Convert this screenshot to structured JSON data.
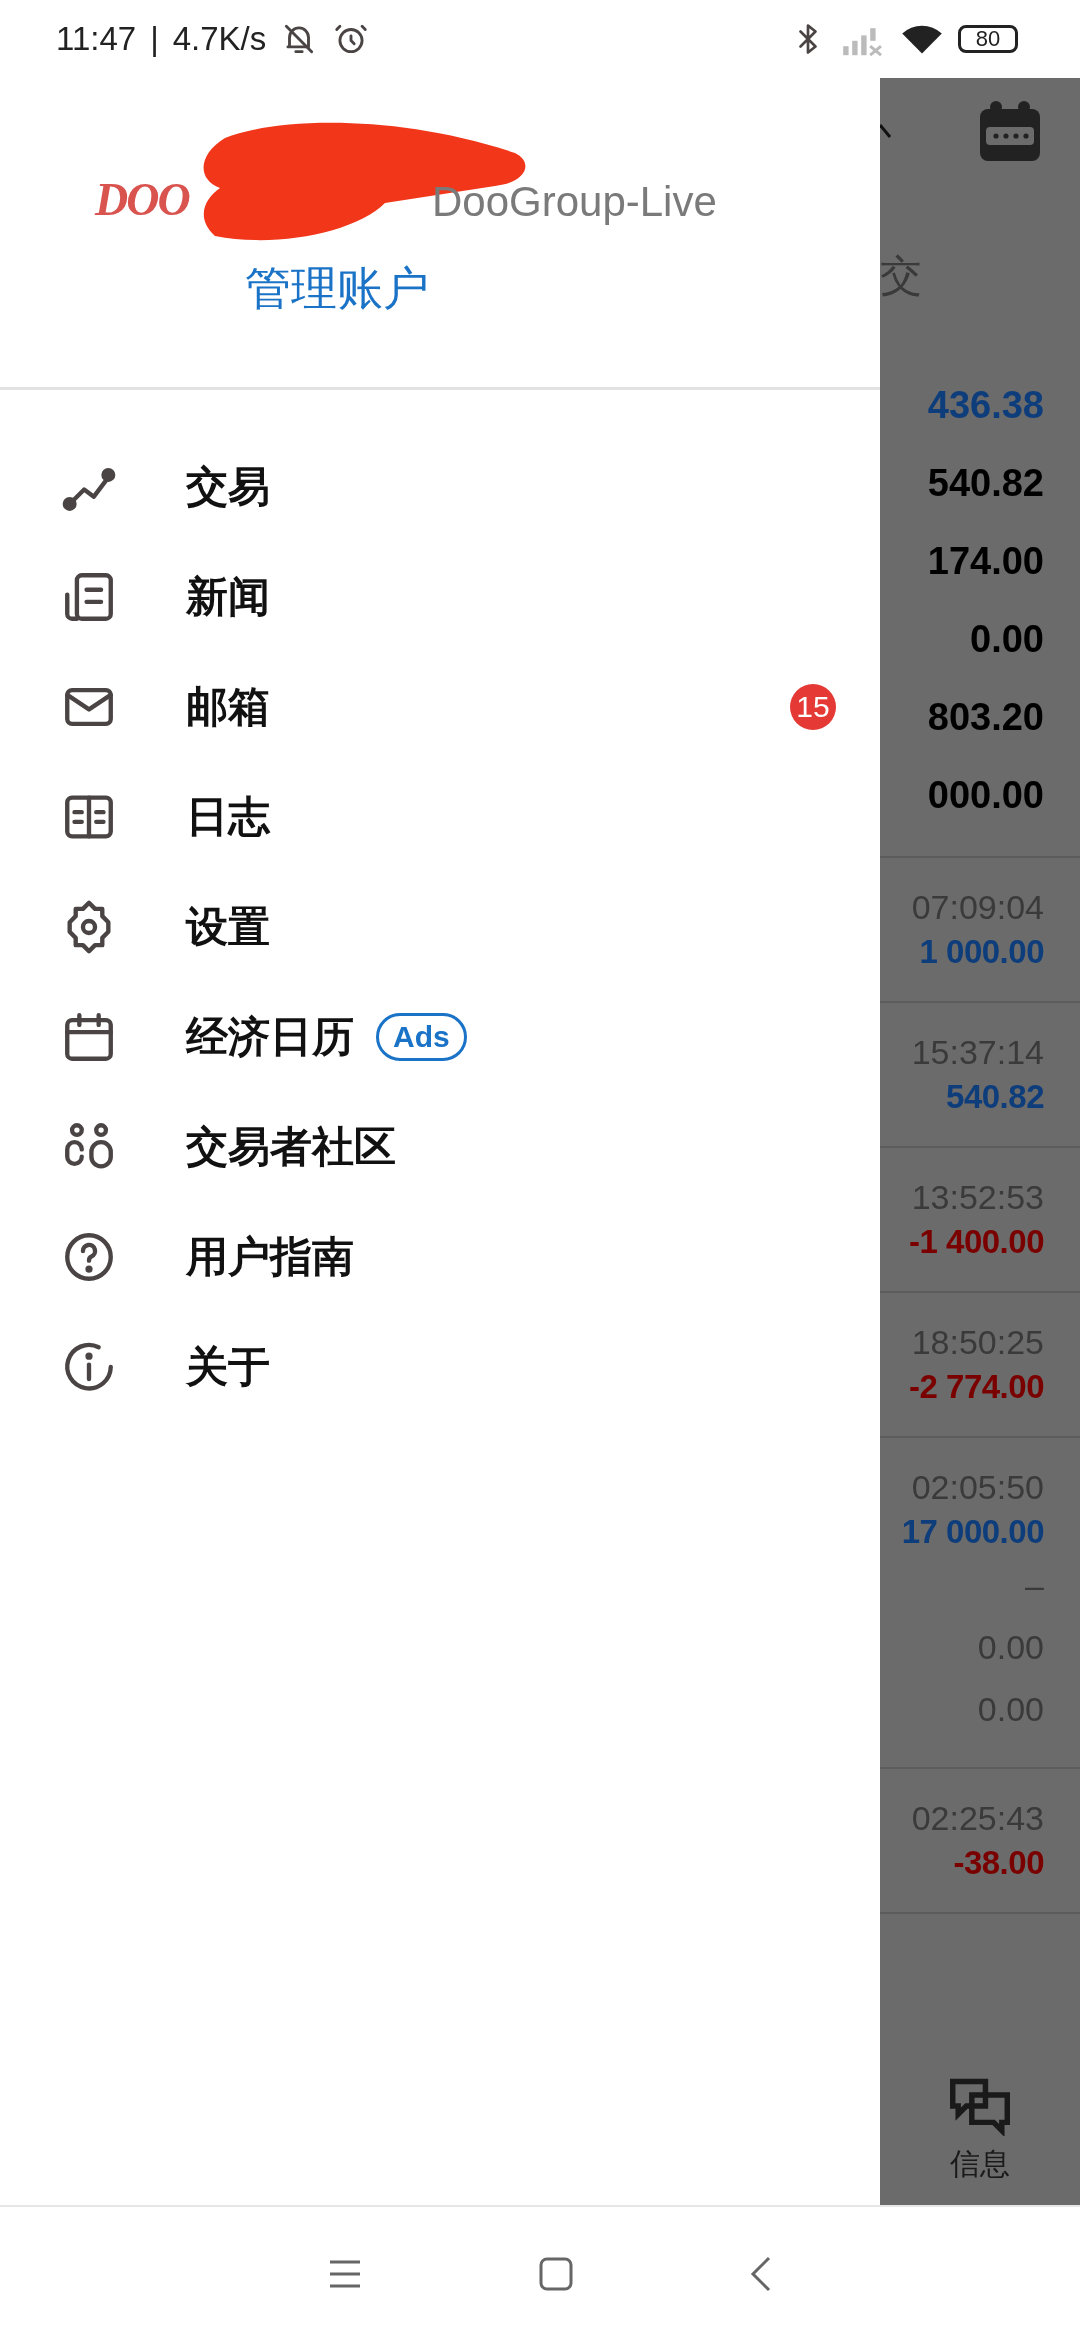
{
  "status_bar": {
    "time": "11:47",
    "separator": "|",
    "speed": "4.7K/s",
    "battery": "80"
  },
  "drawer": {
    "logo": "DOO",
    "server": "DooGroup-Live",
    "manage_link": "管理账户",
    "items": [
      {
        "label": "交易"
      },
      {
        "label": "新闻"
      },
      {
        "label": "邮箱",
        "badge": "15"
      },
      {
        "label": "日志"
      },
      {
        "label": "设置"
      },
      {
        "label": "经济日历",
        "tag": "Ads"
      },
      {
        "label": "交易者社区"
      },
      {
        "label": "用户指南"
      },
      {
        "label": "关于"
      }
    ]
  },
  "background": {
    "column_header": "交",
    "summary": [
      {
        "text": "436.38",
        "color": "#0e3d7c"
      },
      {
        "text": "540.82",
        "color": "#000000"
      },
      {
        "text": "174.00",
        "color": "#000000"
      },
      {
        "text": "0.00",
        "color": "#000000"
      },
      {
        "text": "803.20",
        "color": "#000000"
      },
      {
        "text": "000.00",
        "color": "#000000"
      }
    ],
    "deals": [
      {
        "time": "07:09:04",
        "amount": "1 000.00",
        "color": "#0e3d7c"
      },
      {
        "time": "15:37:14",
        "amount": "540.82",
        "color": "#0e3d7c"
      },
      {
        "time": "13:52:53",
        "amount": "-1 400.00",
        "color": "#7a0000"
      },
      {
        "time": "18:50:25",
        "amount": "-2 774.00",
        "color": "#7a0000"
      },
      {
        "time": "02:05:50",
        "amount": "17 000.00",
        "color": "#0e3d7c",
        "details": [
          "–",
          "0.00",
          "0.00"
        ]
      },
      {
        "time": "02:25:43",
        "amount": "-38.00",
        "color": "#7a0000"
      }
    ],
    "nav_label": "信息"
  }
}
